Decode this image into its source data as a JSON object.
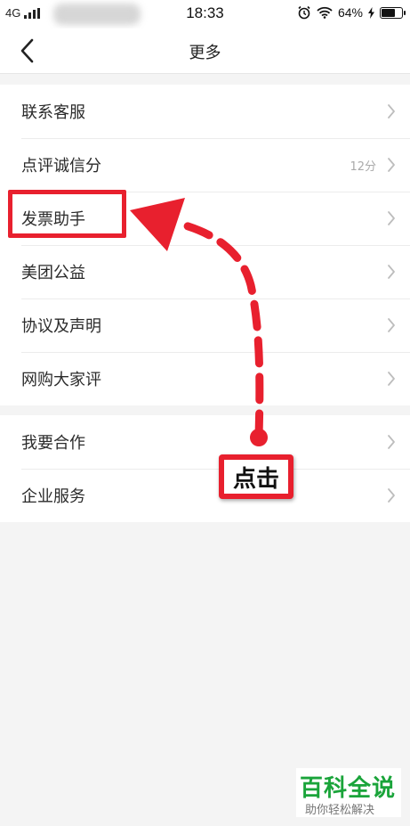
{
  "status_bar": {
    "network": "4G",
    "time": "18:33",
    "battery": "64%",
    "battery_level": 0.64
  },
  "nav": {
    "title": "更多",
    "back_icon": "chevron-left-icon"
  },
  "menu": {
    "group1": [
      {
        "label": "联系客服",
        "value": ""
      },
      {
        "label": "点评诚信分",
        "value": "12分"
      },
      {
        "label": "发票助手",
        "value": ""
      },
      {
        "label": "美团公益",
        "value": ""
      },
      {
        "label": "协议及声明",
        "value": ""
      },
      {
        "label": "网购大家评",
        "value": ""
      }
    ],
    "group2": [
      {
        "label": "我要合作",
        "value": ""
      },
      {
        "label": "企业服务",
        "value": ""
      }
    ]
  },
  "annotation": {
    "callout": "点击",
    "color": "#e8202e"
  },
  "watermark": {
    "title": "百科全说",
    "subtitle": "助你轻松解决",
    "color": "#1aa43a"
  }
}
